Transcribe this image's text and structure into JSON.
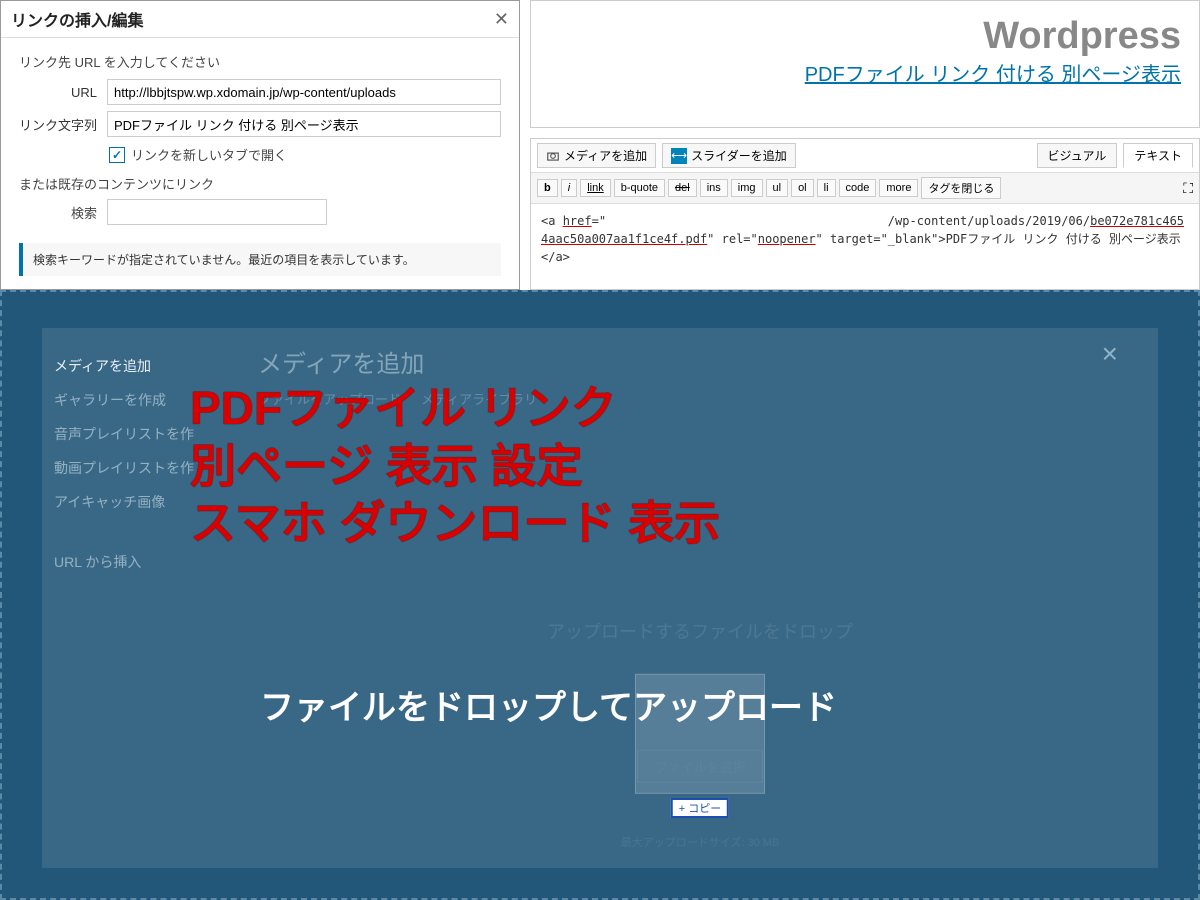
{
  "dialog": {
    "title": "リンクの挿入/編集",
    "instruction": "リンク先 URL を入力してください",
    "url_label": "URL",
    "url_value": "http://lbbjtspw.wp.xdomain.jp/wp-content/uploads",
    "text_label": "リンク文字列",
    "text_value": "PDFファイル リンク 付ける 別ページ表示",
    "checkbox_label": "リンクを新しいタブで開く",
    "or_text": "または既存のコンテンツにリンク",
    "search_label": "検索",
    "info_msg": "検索キーワードが指定されていません。最近の項目を表示しています。"
  },
  "preview": {
    "brand": "Wordpress",
    "link_text": "PDFファイル リンク 付ける 別ページ表示"
  },
  "editor": {
    "media_btn": "メディアを追加",
    "slider_btn": "スライダーを追加",
    "tab_visual": "ビジュアル",
    "tab_text": "テキスト",
    "tags": {
      "b": "b",
      "i": "i",
      "link": "link",
      "bquote": "b-quote",
      "del": "del",
      "ins": "ins",
      "img": "img",
      "ul": "ul",
      "ol": "ol",
      "li": "li",
      "code": "code",
      "more": "more",
      "close": "タグを閉じる"
    },
    "code_html": "<a href=\"                                /wp-content/uploads/2019/06/be072e781c4654aac50a007aa1f1ce4f.pdf\" rel=\"noopener\" target=\"_blank\">PDFファイル リンク 付ける 別ページ表示</a>"
  },
  "media": {
    "side": {
      "add": "メディアを追加",
      "gallery": "ギャラリーを作成",
      "audio": "音声プレイリストを作",
      "video": "動画プレイリストを作",
      "featured": "アイキャッチ画像",
      "url": "URL から挿入"
    },
    "title": "メディアを追加",
    "tab_upload": "ファイルをアップロード",
    "tab_library": "メディアライブラリ",
    "drop_text": "アップロードするファイルをドロップ",
    "file_btn": "ファイルを選択",
    "max_text": "最大アップロードサイズ: 30 MB",
    "copy": "+ コピー"
  },
  "headline": {
    "l1": "PDFファイル リンク",
    "l2": "別ページ 表示 設定",
    "l3": "スマホ ダウンロード 表示",
    "sub": "ファイルをドロップしてアップロード"
  }
}
